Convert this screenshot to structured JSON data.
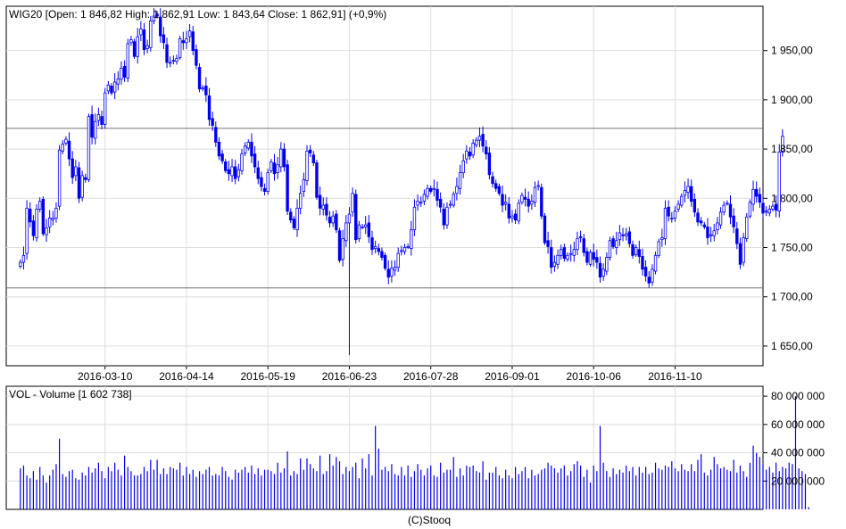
{
  "footer": "(C)Stooq",
  "colors": {
    "candle": "#0000ee",
    "volume": "#0000ee",
    "grid": "#dddddd",
    "axis": "#000000",
    "refline": "#707070"
  },
  "chart_data": [
    {
      "type": "candlestick",
      "title": "WIG20 [Open: 1 846,82  High: 1 862,91  Low: 1 843,64  Close: 1 862,91] (+0,9%)",
      "x_tick_labels": [
        "2016-03-10",
        "2016-04-14",
        "2016-05-19",
        "2016-06-23",
        "2016-07-28",
        "2016-09-01",
        "2016-10-06",
        "2016-11-10"
      ],
      "x_tick_index": [
        26,
        51,
        76,
        101,
        126,
        151,
        176,
        201
      ],
      "y_ticks": [
        1650,
        1700,
        1750,
        1800,
        1850,
        1900,
        1950
      ],
      "y_tick_labels": [
        "1 650,00",
        "1 700,00",
        "1 750,00",
        "1 800,00",
        "1 850,00",
        "1 900,00",
        "1 950,00"
      ],
      "ylim": [
        1630,
        1995
      ],
      "reference_lines": [
        1871,
        1709
      ],
      "grid": true,
      "closes": [
        1735,
        1742,
        1790,
        1776,
        1762,
        1789,
        1797,
        1764,
        1770,
        1780,
        1780,
        1790,
        1849,
        1855,
        1860,
        1840,
        1821,
        1832,
        1800,
        1823,
        1819,
        1883,
        1862,
        1878,
        1885,
        1875,
        1907,
        1915,
        1907,
        1918,
        1921,
        1932,
        1923,
        1957,
        1961,
        1944,
        1964,
        1972,
        1951,
        1955,
        1980,
        1985,
        1985,
        1965,
        1958,
        1938,
        1938,
        1940,
        1942,
        1962,
        1958,
        1962,
        1970,
        1950,
        1935,
        1911,
        1912,
        1905,
        1880,
        1874,
        1857,
        1843,
        1838,
        1828,
        1825,
        1832,
        1820,
        1829,
        1845,
        1853,
        1857,
        1843,
        1832,
        1820,
        1812,
        1807,
        1826,
        1837,
        1825,
        1834,
        1850,
        1832,
        1787,
        1778,
        1770,
        1790,
        1805,
        1819,
        1848,
        1846,
        1836,
        1801,
        1790,
        1793,
        1783,
        1775,
        1782,
        1768,
        1737,
        1759,
        1775,
        1784,
        1805,
        1758,
        1773,
        1771,
        1773,
        1761,
        1748,
        1751,
        1746,
        1740,
        1729,
        1720,
        1729,
        1730,
        1744,
        1747,
        1750,
        1751,
        1768,
        1791,
        1797,
        1796,
        1804,
        1810,
        1807,
        1810,
        1798,
        1791,
        1773,
        1791,
        1794,
        1804,
        1812,
        1826,
        1838,
        1848,
        1843,
        1856,
        1859,
        1863,
        1853,
        1845,
        1824,
        1815,
        1810,
        1805,
        1793,
        1796,
        1780,
        1782,
        1778,
        1795,
        1803,
        1799,
        1792,
        1797,
        1811,
        1813,
        1782,
        1755,
        1751,
        1730,
        1735,
        1742,
        1748,
        1739,
        1742,
        1744,
        1748,
        1759,
        1760,
        1745,
        1735,
        1745,
        1738,
        1735,
        1720,
        1728,
        1740,
        1757,
        1751,
        1757,
        1765,
        1762,
        1764,
        1754,
        1742,
        1750,
        1741,
        1728,
        1721,
        1714,
        1728,
        1742,
        1756,
        1760,
        1790,
        1782,
        1780,
        1787,
        1794,
        1802,
        1808,
        1812,
        1797,
        1786,
        1776,
        1775,
        1771,
        1760,
        1763,
        1767,
        1775,
        1786,
        1793,
        1795,
        1781,
        1771,
        1754,
        1733,
        1760,
        1781,
        1796,
        1809,
        1802,
        1796,
        1785,
        1787,
        1789,
        1792,
        1788,
        1847,
        1863
      ],
      "last_bar": {
        "open": "1 846,82",
        "high": "1 862,91",
        "low": "1 843,64",
        "close": "1 862,91",
        "change": "+0,9%"
      }
    },
    {
      "type": "bar",
      "title": "VOL - Volume [1 602 738]",
      "y_ticks": [
        20000000,
        40000000,
        60000000,
        80000000
      ],
      "y_tick_labels": [
        "20 000 000",
        "40 000 000",
        "60 000 000",
        "80 000 000"
      ],
      "ylim": [
        0,
        87000000
      ],
      "grid": true,
      "values": [
        29000000,
        31000000,
        24000000,
        22000000,
        27000000,
        21000000,
        30000000,
        24000000,
        19000000,
        24000000,
        28000000,
        32000000,
        50000000,
        25000000,
        23000000,
        27000000,
        28000000,
        22000000,
        21000000,
        26000000,
        24000000,
        30000000,
        26000000,
        29000000,
        33000000,
        27000000,
        22000000,
        30000000,
        27000000,
        33000000,
        28000000,
        24000000,
        38000000,
        30000000,
        27000000,
        24000000,
        24000000,
        25000000,
        30000000,
        27000000,
        35000000,
        28000000,
        35000000,
        25000000,
        29000000,
        25000000,
        30000000,
        29000000,
        28000000,
        33000000,
        24000000,
        30000000,
        25000000,
        28000000,
        23000000,
        27000000,
        25000000,
        28000000,
        30000000,
        24000000,
        25000000,
        24000000,
        30000000,
        27000000,
        23000000,
        21000000,
        28000000,
        26000000,
        28000000,
        30000000,
        26000000,
        31000000,
        25000000,
        29000000,
        24000000,
        28000000,
        28000000,
        27000000,
        25000000,
        33000000,
        26000000,
        29000000,
        41000000,
        24000000,
        27000000,
        25000000,
        36000000,
        28000000,
        36000000,
        32000000,
        29000000,
        27000000,
        38000000,
        25000000,
        27000000,
        39000000,
        31000000,
        37000000,
        34000000,
        25000000,
        30000000,
        27000000,
        30000000,
        33000000,
        22000000,
        36000000,
        29000000,
        39000000,
        24000000,
        59000000,
        43000000,
        28000000,
        30000000,
        27000000,
        32000000,
        25000000,
        24000000,
        30000000,
        24000000,
        31000000,
        23000000,
        27000000,
        32000000,
        28000000,
        24000000,
        29000000,
        31000000,
        24000000,
        23000000,
        33000000,
        26000000,
        28000000,
        28000000,
        37000000,
        23000000,
        29000000,
        24000000,
        31000000,
        30000000,
        31000000,
        27000000,
        26000000,
        34000000,
        21000000,
        26000000,
        26000000,
        30000000,
        24000000,
        22000000,
        28000000,
        24000000,
        22000000,
        30000000,
        25000000,
        27000000,
        30000000,
        22000000,
        28000000,
        24000000,
        25000000,
        28000000,
        29000000,
        33000000,
        31000000,
        29000000,
        26000000,
        29000000,
        31000000,
        24000000,
        27000000,
        32000000,
        34000000,
        31000000,
        23000000,
        28000000,
        19000000,
        31000000,
        27000000,
        59000000,
        33000000,
        27000000,
        23000000,
        29000000,
        25000000,
        28000000,
        26000000,
        31000000,
        27000000,
        30000000,
        24000000,
        30000000,
        26000000,
        30000000,
        25000000,
        26000000,
        33000000,
        29000000,
        28000000,
        31000000,
        30000000,
        34000000,
        29000000,
        27000000,
        32000000,
        28000000,
        27000000,
        32000000,
        27000000,
        35000000,
        39000000,
        26000000,
        24000000,
        28000000,
        37000000,
        32000000,
        29000000,
        30000000,
        28000000,
        27000000,
        35000000,
        26000000,
        31000000,
        27000000,
        23000000,
        33000000,
        45000000,
        40000000,
        37000000,
        32000000,
        28000000,
        30000000,
        26000000,
        33000000,
        27000000,
        30000000,
        29000000,
        33000000,
        32000000,
        80000000,
        29000000,
        27000000,
        25000000,
        1602738
      ]
    }
  ]
}
